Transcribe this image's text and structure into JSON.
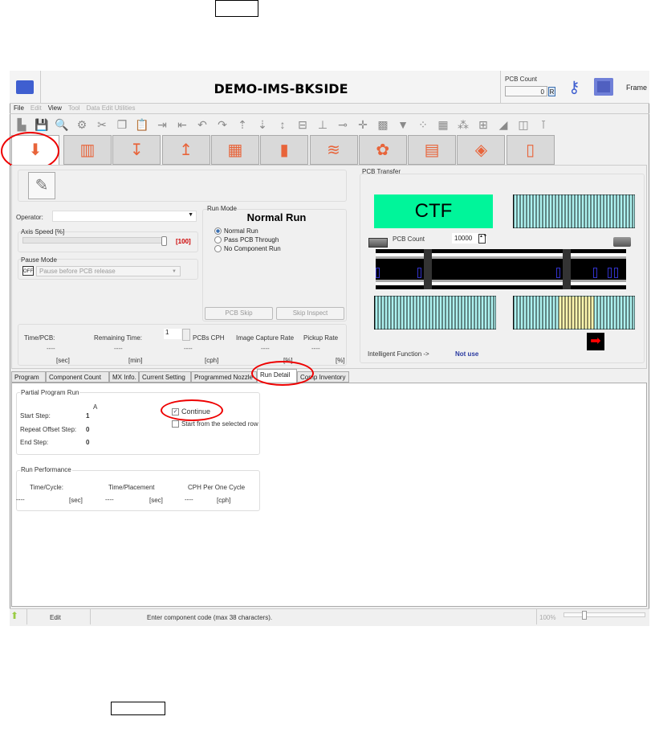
{
  "window": {
    "title": "DEMO-IMS-BKSIDE"
  },
  "header": {
    "pcb_count_label": "PCB Count",
    "pcb_count_value": "0",
    "reset_label": "R",
    "frame_label": "Frame"
  },
  "menu": [
    {
      "label": "File",
      "enabled": true
    },
    {
      "label": "Edit",
      "enabled": false
    },
    {
      "label": "View",
      "enabled": true
    },
    {
      "label": "Tool",
      "enabled": false
    },
    {
      "label": "Data Edit Utilities",
      "enabled": false
    }
  ],
  "toolbar_icons": [
    "new",
    "save",
    "search",
    "settings",
    "cut",
    "copy",
    "paste",
    "insert-row",
    "delete-row",
    "undo",
    "redo",
    "move-up",
    "move-down",
    "move-center",
    "feeder",
    "nozzle",
    "pickup",
    "crosshair",
    "image",
    "download",
    "grid",
    "component",
    "placement",
    "tray",
    "mark",
    "fiducial",
    "measure"
  ],
  "main_tabs": [
    {
      "icon": "run-icon",
      "glyph": "⬇",
      "active": true
    },
    {
      "icon": "inspect-icon",
      "glyph": "▥"
    },
    {
      "icon": "place-down-icon",
      "glyph": "↧"
    },
    {
      "icon": "place-up-icon",
      "glyph": "↥"
    },
    {
      "icon": "board-size-icon",
      "glyph": "▦"
    },
    {
      "icon": "chip-icon",
      "glyph": "▮"
    },
    {
      "icon": "feeder-icon",
      "glyph": "≋"
    },
    {
      "icon": "reel-icon",
      "glyph": "✿"
    },
    {
      "icon": "document-icon",
      "glyph": "▤"
    },
    {
      "icon": "layers-icon",
      "glyph": "◈"
    },
    {
      "icon": "nozzles-icon",
      "glyph": "▯"
    }
  ],
  "left": {
    "operator_label": "Operator:",
    "operator_value": "",
    "axis_speed_label": "Axis Speed [%]",
    "axis_speed_value": 100,
    "axis_speed_text": "[100]",
    "pause_mode_label": "Pause Mode",
    "pause_toggle": "OFF",
    "pause_select": "Pause before PCB release",
    "run_mode_label": "Run Mode",
    "run_mode_value": "Normal Run",
    "run_modes": [
      {
        "label": "Normal Run",
        "selected": true
      },
      {
        "label": "Pass PCB Through",
        "selected": false
      },
      {
        "label": "No Component Run",
        "selected": false
      }
    ],
    "pcb_skip": "PCB Skip",
    "skip_inspect": "Skip Inspect"
  },
  "stats": {
    "time_pcb": {
      "label": "Time/PCB:",
      "value": "----",
      "unit": "[sec]"
    },
    "remaining": {
      "label": "Remaining Time:",
      "value": "----",
      "unit": "[min]"
    },
    "pcbs_cph": {
      "label": "PCBs CPH",
      "spinner": "1",
      "value": "----",
      "unit": "[cph]"
    },
    "image_rate": {
      "label": "Image Capture Rate",
      "value": "----",
      "unit": "[%]"
    },
    "pickup_rate": {
      "label": "Pickup Rate",
      "value": "----",
      "unit": "[%]"
    }
  },
  "pcb_transfer": {
    "label": "PCB Transfer",
    "status": "CTF",
    "status_color": "#00f59a",
    "pcb_count_label": "PCB Count",
    "pcb_count_value": "10000",
    "intelligent_label": "Intelligent Function ->",
    "intelligent_value": "Not use",
    "arrow_color": "#ff0000"
  },
  "lower_tabs": [
    {
      "label": "Program"
    },
    {
      "label": "Component Count"
    },
    {
      "label": "MX Info."
    },
    {
      "label": "Current Setting"
    },
    {
      "label": "Programmed Nozzle"
    },
    {
      "label": "Run Detail",
      "active": true
    },
    {
      "label": "Comp Inventory"
    }
  ],
  "run_detail": {
    "partial_label": "Partial Program Run",
    "column_label": "A",
    "start_step_label": "Start Step:",
    "start_step": "1",
    "repeat_offset_label": "Repeat Offset Step:",
    "repeat_offset": "0",
    "end_step_label": "End Step:",
    "end_step": "0",
    "continue_label": "Continue",
    "continue_checked": true,
    "start_selected_label": "Start from the selected row",
    "start_selected_checked": false,
    "performance_label": "Run Performance",
    "time_cycle": {
      "label": "Time/Cycle:",
      "value": "----",
      "unit": "[sec]"
    },
    "time_placement": {
      "label": "Time/Placement",
      "value": "----",
      "unit": "[sec]"
    },
    "cph_cycle": {
      "label": "CPH Per One Cycle",
      "value": "----",
      "unit": "[cph]"
    }
  },
  "status_bar": {
    "mode": "Edit",
    "message": "Enter component code (max 38 characters).",
    "zoom": "100%"
  }
}
